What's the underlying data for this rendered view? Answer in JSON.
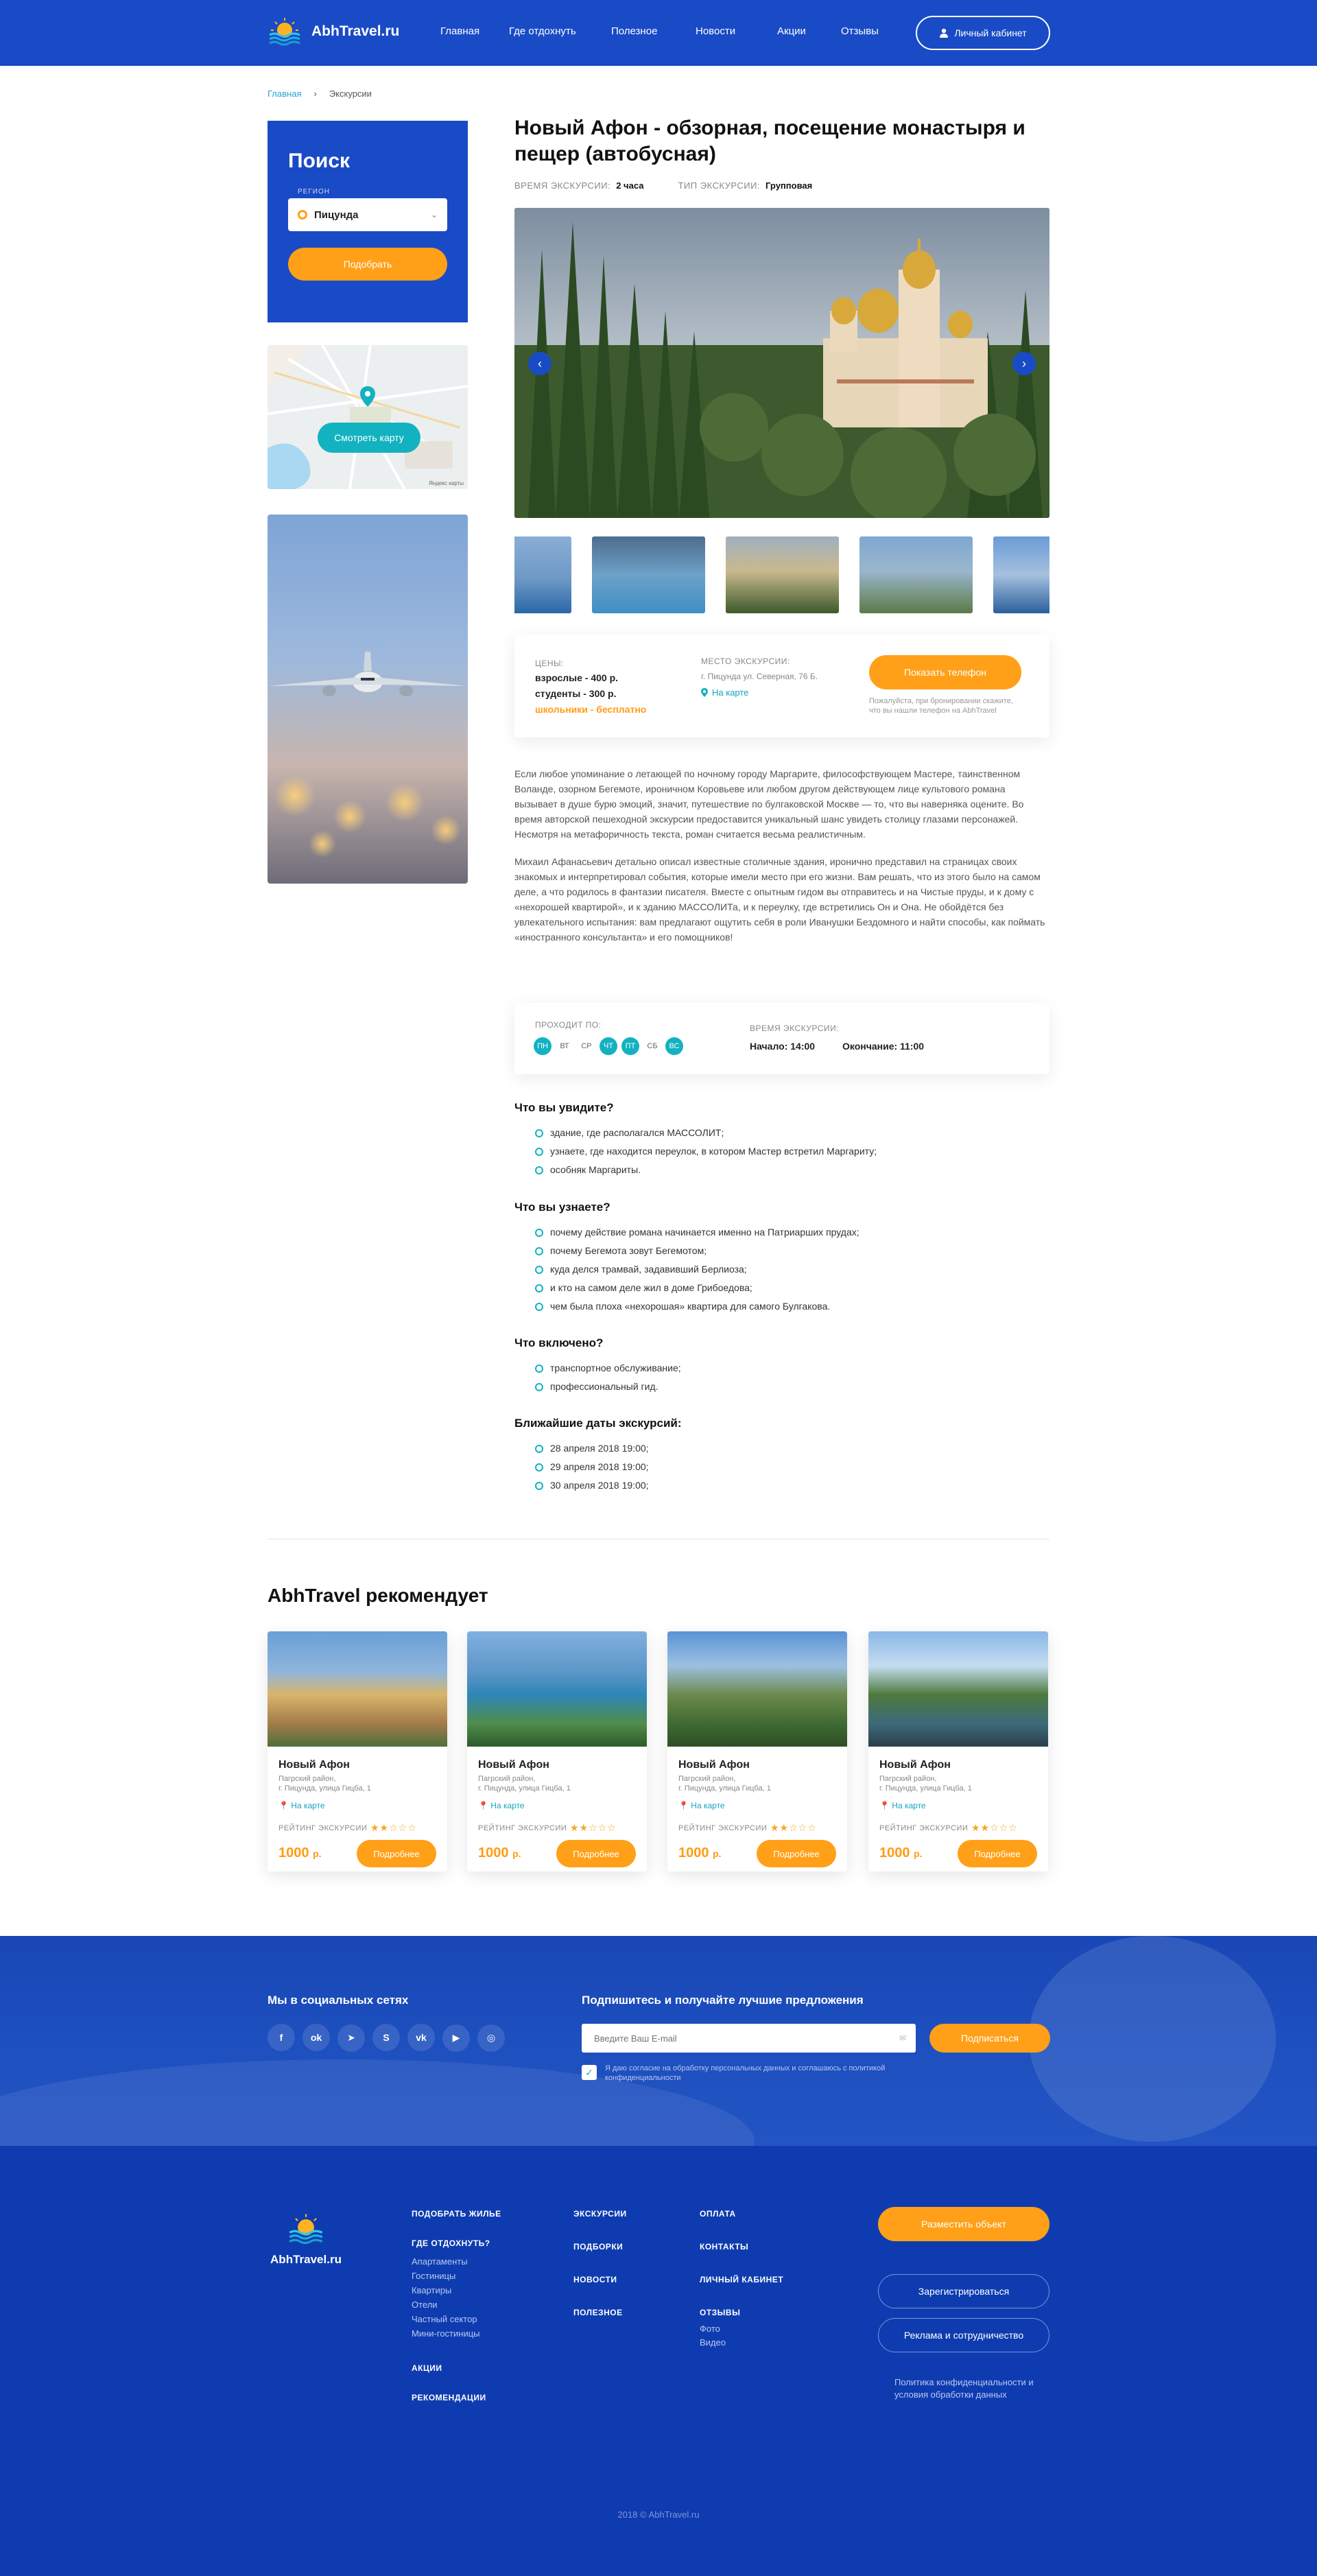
{
  "header": {
    "logo": "AbhTravel.ru",
    "nav": [
      "Главная",
      "Где отдохнуть",
      "Полезное",
      "Новости",
      "Акции",
      "Отзывы"
    ],
    "cabinet": "Личный кабинет"
  },
  "breadcrumbs": {
    "home": "Главная",
    "sep": "›",
    "current": "Экскурсии"
  },
  "search": {
    "title": "Поиск",
    "region_label": "РЕГИОН",
    "region_value": "Пицунда",
    "button": "Подобрать"
  },
  "map": {
    "button": "Смотреть карту",
    "credit": "Яндекс карты"
  },
  "tour": {
    "title": "Новый Афон - обзорная, посещение монастыря и пещер (автобусная)",
    "duration_label": "ВРЕМЯ ЭКСКУРСИИ:",
    "duration": "2 часа",
    "type_label": "ТИП ЭКСКУРСИИ:",
    "type": "Групповая"
  },
  "prices": {
    "label": "ЦЕНЫ:",
    "adults": "взрослые - 400 р.",
    "students": "студенты - 300 р.",
    "kids": "школьники - бесплатно",
    "place_label": "МЕСТО ЭКСКУРСИИ:",
    "place": "г. Пицунда ул. Северная, 76 Б.",
    "on_map": "На карте",
    "phone_button": "Показать телефон",
    "phone_note": "Пожалуйста, при бронировании скажите, что вы нашли телефон на AbhTravel"
  },
  "description": [
    "Если любое упоминание о летающей по ночному городу Маргарите, философствующем Мастере, таинственном Воланде, озорном Бегемоте, ироничном Коровьеве или любом другом действующем лице культового романа вызывает в душе бурю эмоций, значит, путешествие по булгаковской Москве — то, что вы наверняка оцените. Во время авторской пешеходной экскурсии предоставится уникальный шанс увидеть столицу глазами персонажей. Несмотря на метафоричность текста, роман считается весьма реалистичным.",
    "Михаил Афанасьевич детально описал известные столичные здания, иронично представил на страницах своих знакомых и интерпретировал события, которые имели место при его жизни. Вам решать, что из этого было на самом деле, а что родилось в фантазии писателя. Вместе с опытным гидом вы отправитесь и на Чистые пруды, и к дому с «нехорошей квартирой», и к зданию МАССОЛИТа, и к переулку, где встретились Он и Она. Не обойдётся без увлекательного испытания: вам предлагают ощутить себя в роли Иванушки Бездомного и найти способы, как поймать «иностранного консультанта» и его помощников!"
  ],
  "schedule": {
    "label": "ПРОХОДИТ ПО:",
    "days": [
      {
        "d": "ПН",
        "on": true
      },
      {
        "d": "ВТ",
        "on": false
      },
      {
        "d": "СР",
        "on": false
      },
      {
        "d": "ЧТ",
        "on": true
      },
      {
        "d": "ПТ",
        "on": true
      },
      {
        "d": "СБ",
        "on": false
      },
      {
        "d": "ВС",
        "on": true
      }
    ],
    "time_label": "ВРЕМЯ ЭКСКУРСИИ:",
    "start": "Начало: 14:00",
    "end": "Окончание: 11:00"
  },
  "see": {
    "title": "Что вы увидите?",
    "items": [
      "здание, где располагался МАССОЛИТ;",
      "узнаете, где находится переулок, в котором Мастер встретил Маргариту;",
      "особняк Маргариты."
    ]
  },
  "learn": {
    "title": "Что вы узнаете?",
    "items": [
      "почему действие романа начинается именно на Патриарших прудах;",
      "почему Бегемота зовут Бегемотом;",
      "куда делся трамвай, задавивший Берлиоза;",
      "и кто на самом деле жил в доме Грибоедова;",
      "чем была плоха «нехорошая» квартира для самого Булгакова."
    ]
  },
  "included": {
    "title": "Что включено?",
    "items": [
      "транспортное обслуживание;",
      "профессиональный гид."
    ]
  },
  "dates": {
    "title": "Ближайшие даты экскурсий:",
    "items": [
      "28 апреля 2018 19:00;",
      "29 апреля 2018 19:00;",
      "30 апреля 2018 19:00;"
    ]
  },
  "recommend": {
    "title": "AbhTravel рекомендует",
    "cards": [
      {
        "name": "Новый Афон",
        "addr1": "Пагрский район,",
        "addr2": "г. Пицунда, улица Гицба, 1",
        "map": "На карте",
        "rating_label": "РЕЙТИНГ ЭКСКУРСИИ",
        "stars": "★★☆☆☆",
        "price": "1000",
        "currency": "р.",
        "button": "Подробнее"
      },
      {
        "name": "Новый Афон",
        "addr1": "Пагрский район,",
        "addr2": "г. Пицунда, улица Гицба, 1",
        "map": "На карте",
        "rating_label": "РЕЙТИНГ ЭКСКУРСИИ",
        "stars": "★★☆☆☆",
        "price": "1000",
        "currency": "р.",
        "button": "Подробнее"
      },
      {
        "name": "Новый Афон",
        "addr1": "Пагрский район,",
        "addr2": "г. Пицунда, улица Гицба, 1",
        "map": "На карте",
        "rating_label": "РЕЙТИНГ ЭКСКУРСИИ",
        "stars": "★★☆☆☆",
        "price": "1000",
        "currency": "р.",
        "button": "Подробнее"
      },
      {
        "name": "Новый Афон",
        "addr1": "Пагрский район,",
        "addr2": "г. Пицунда, улица Гицба, 1",
        "map": "На карте",
        "rating_label": "РЕЙТИНГ ЭКСКУРСИИ",
        "stars": "★★☆☆☆",
        "price": "1000",
        "currency": "р.",
        "button": "Подробнее"
      }
    ]
  },
  "social": {
    "title": "Мы в социальных сетях",
    "icons": [
      "facebook-icon",
      "odnoklassniki-icon",
      "telegram-icon",
      "skype-icon",
      "vk-icon",
      "youtube-icon",
      "instagram-icon"
    ],
    "glyphs": [
      "f",
      "ok",
      "➤",
      "S",
      "vk",
      "▶",
      "◎"
    ]
  },
  "subscribe": {
    "title": "Подпишитесь и получайте лучшие предложения",
    "placeholder": "Введите Ваш E-mail",
    "button": "Подписаться",
    "consent": "Я даю согласие на обработку персональных данных и соглашаюсь с политикой конфиденциальности"
  },
  "footer": {
    "logo": "AbhTravel.ru",
    "col1": {
      "h1": "ПОДОБРАТЬ ЖИЛЬЕ",
      "h2": "ГДЕ ОТДОХНУТЬ?",
      "links": [
        "Апартаменты",
        "Гостиницы",
        "Квартиры",
        "Отели",
        "Частный сектор",
        "Мини-гостиницы"
      ],
      "h3": "АКЦИИ",
      "h4": "РЕКОМЕНДАЦИИ"
    },
    "col2": [
      "ЭКСКУРСИИ",
      "ПОДБОРКИ",
      "НОВОСТИ",
      "ПОЛЕЗНОЕ"
    ],
    "col3": {
      "h1": "ОПЛАТА",
      "h2": "КОНТАКТЫ",
      "h3": "ЛИЧНЫЙ КАБИНЕТ",
      "h4": "ОТЗЫВЫ",
      "links": [
        "Фото",
        "Видео"
      ]
    },
    "place_button": "Разместить объект",
    "register_button": "Зарегистрироваться",
    "ads_button": "Реклама и сотрудничество",
    "policy": "Политика конфиденциальности и условия обработки данных",
    "copyright": "2018 © AbhTravel.ru"
  },
  "colors": {
    "brand_blue": "#1a4bc6",
    "accent_orange": "#ffa018",
    "teal": "#13b2c0",
    "footer_blue": "#0e3cb0"
  }
}
